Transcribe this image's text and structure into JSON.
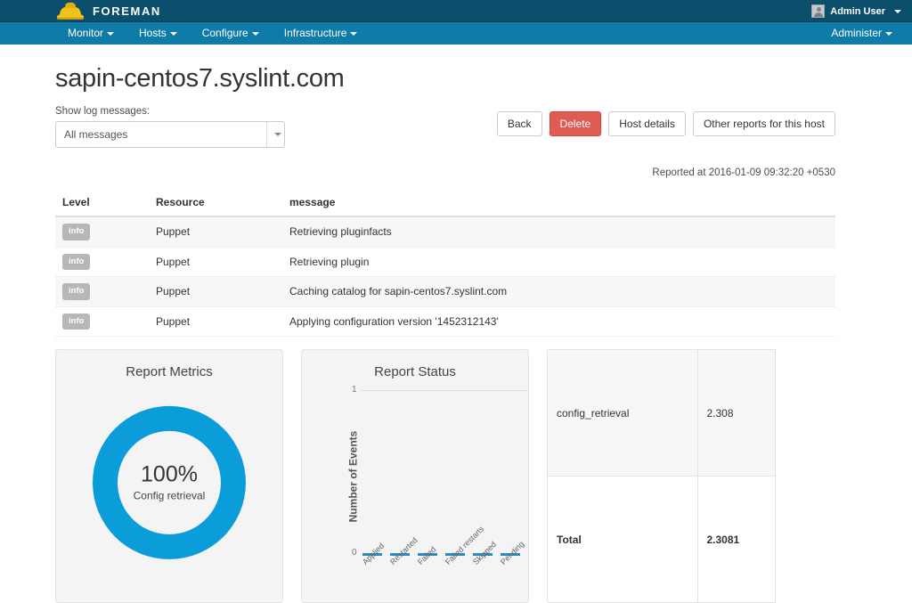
{
  "topbar": {
    "brand": "FOREMAN",
    "brand_icon": "hardhat-icon",
    "user": "Admin User",
    "user_icon": "avatar-icon"
  },
  "nav": {
    "items": [
      {
        "label": "Monitor"
      },
      {
        "label": "Hosts"
      },
      {
        "label": "Configure"
      },
      {
        "label": "Infrastructure"
      }
    ],
    "right": [
      {
        "label": "Administer"
      }
    ]
  },
  "page": {
    "title": "sapin-centos7.syslint.com",
    "reported_at": "Reported at 2016-01-09 09:32:20 +0530"
  },
  "filter": {
    "label": "Show log messages:",
    "selected": "All messages"
  },
  "buttons": {
    "back": "Back",
    "delete": "Delete",
    "host_details": "Host details",
    "other_reports": "Other reports for this host"
  },
  "log_table": {
    "headers": [
      "Level",
      "Resource",
      "message"
    ],
    "rows": [
      {
        "level": "info",
        "resource": "Puppet",
        "message": "Retrieving pluginfacts"
      },
      {
        "level": "info",
        "resource": "Puppet",
        "message": "Retrieving plugin"
      },
      {
        "level": "info",
        "resource": "Puppet",
        "message": "Caching catalog for sapin-centos7.syslint.com"
      },
      {
        "level": "info",
        "resource": "Puppet",
        "message": "Applying configuration version '1452312143'"
      }
    ]
  },
  "metrics_panel": {
    "title": "Report Metrics",
    "percent": "100%",
    "label": "Config retrieval",
    "color": "#0b9dda"
  },
  "metrics_table": {
    "rows": [
      {
        "name": "config_retrieval",
        "value": "2.308"
      },
      {
        "name": "Total",
        "value": "2.3081"
      }
    ]
  },
  "chart_data": {
    "type": "bar",
    "title": "Report Status",
    "xlabel": "",
    "ylabel": "Number of Events",
    "categories": [
      "Applied",
      "Restarted",
      "Failed",
      "Failed restarts",
      "Skipped",
      "Pending"
    ],
    "values": [
      0,
      0,
      0,
      0,
      0,
      0
    ],
    "ylim": [
      0,
      1
    ],
    "yticks": [
      "0",
      "1"
    ],
    "grid": true,
    "legend": "none",
    "series_color": "#2b8cbe"
  },
  "colors": {
    "topbar": "#0b4f6c",
    "navbar": "#0f7ba8",
    "danger": "#e05b54",
    "accent": "#0b9dda",
    "hat": "#f2c21a"
  }
}
